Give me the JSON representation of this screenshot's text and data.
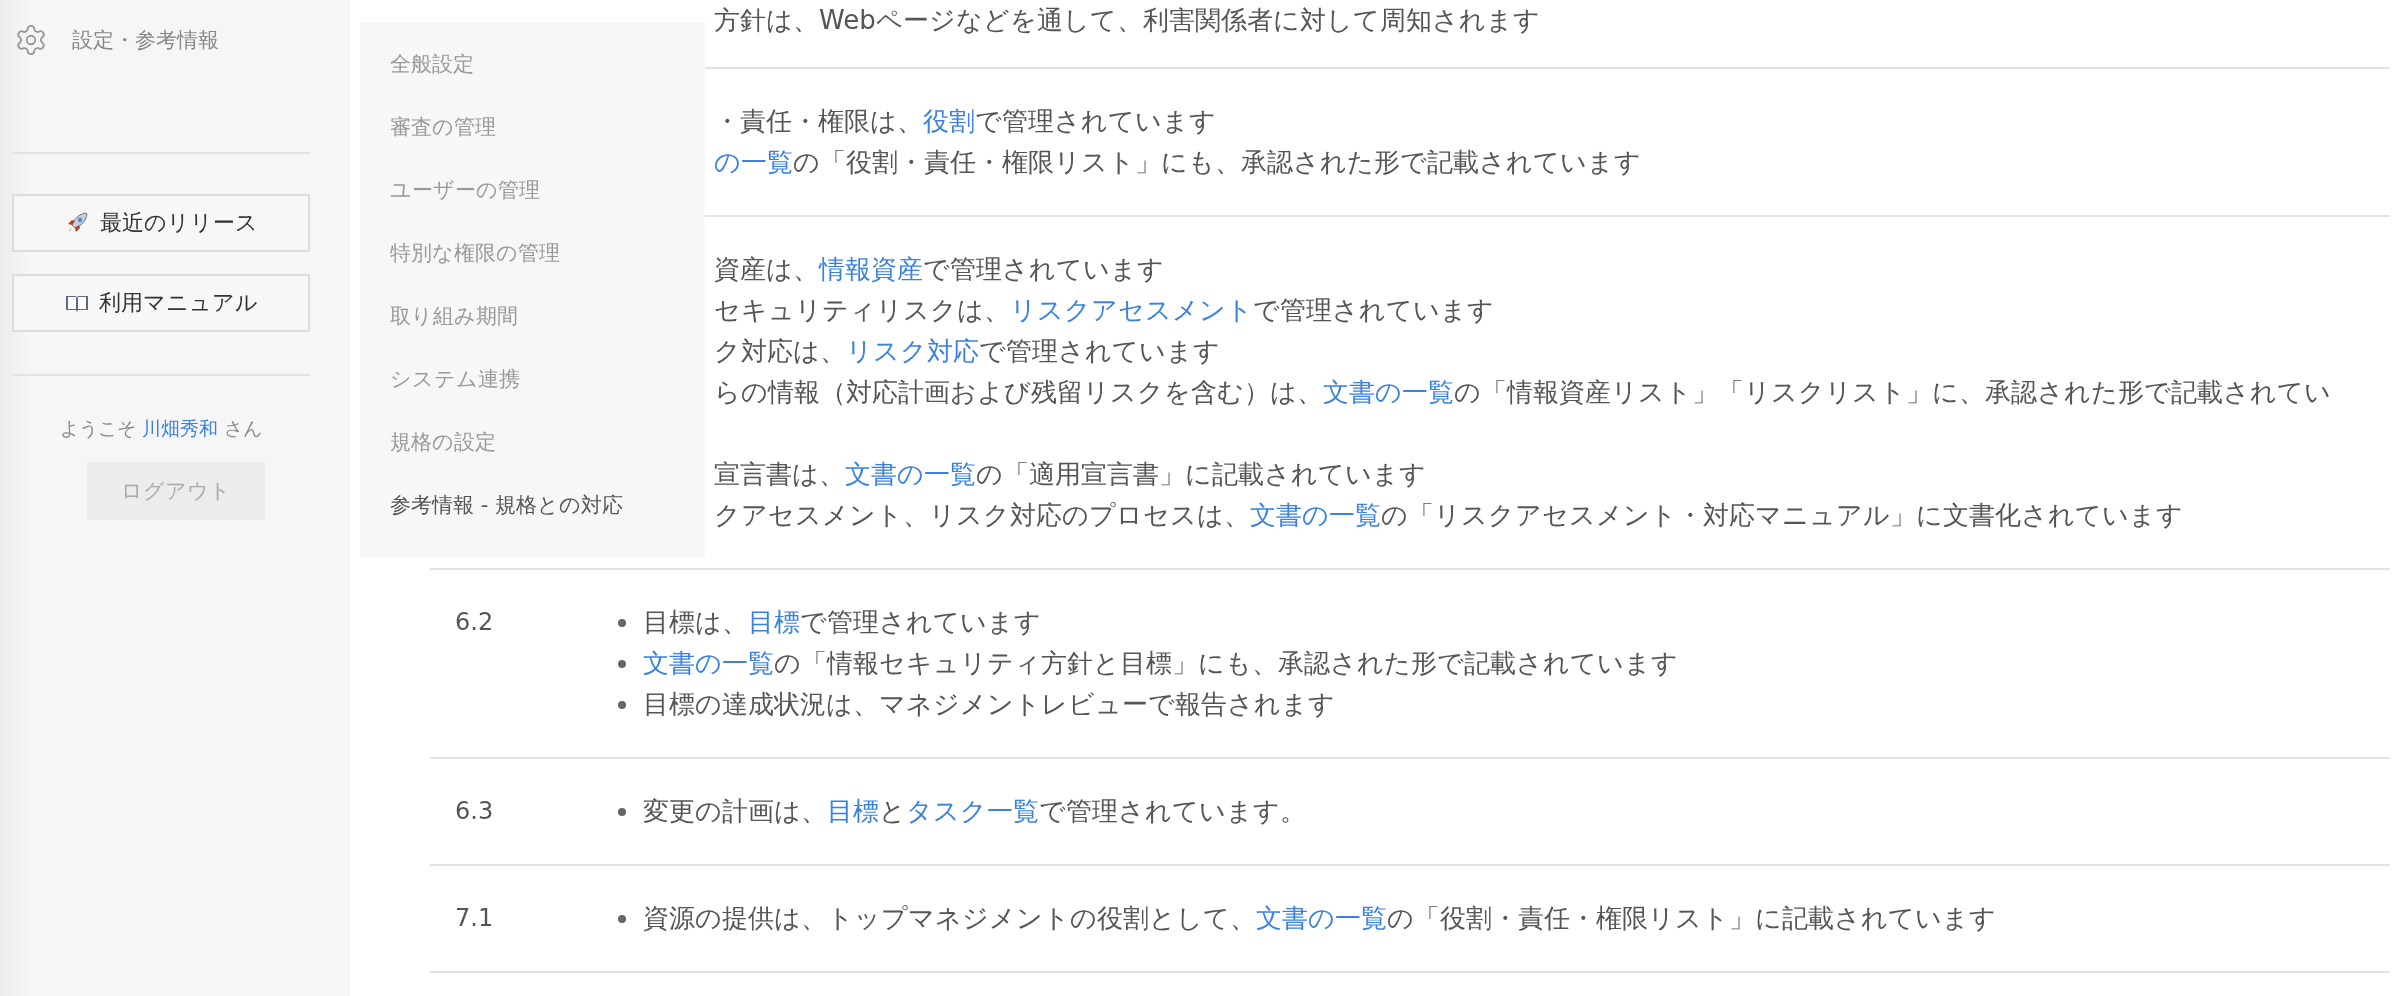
{
  "sidebar": {
    "header": "設定・参考情報",
    "buttons": [
      {
        "label": "最近のリリース"
      },
      {
        "label": "利用マニュアル"
      }
    ],
    "welcome": {
      "prefix": "ようこそ",
      "user": "川畑秀和",
      "suffix": "さん"
    },
    "logout": "ログアウト"
  },
  "menu": [
    {
      "label": "全般設定",
      "selected": false
    },
    {
      "label": "審査の管理",
      "selected": false
    },
    {
      "label": "ユーザーの管理",
      "selected": false
    },
    {
      "label": "特別な権限の管理",
      "selected": false
    },
    {
      "label": "取り組み期間",
      "selected": false
    },
    {
      "label": "システム連携",
      "selected": false
    },
    {
      "label": "規格の設定",
      "selected": false
    },
    {
      "label": "参考情報 - 規格との対応",
      "selected": true
    }
  ],
  "rows": [
    {
      "items": [
        {
          "segments": [
            {
              "kind": "text",
              "text": "方針は、Webページなどを通して、利害関係者に対して周知されます"
            }
          ]
        }
      ]
    },
    {
      "items": [
        {
          "segments": [
            {
              "kind": "text",
              "text": "・責任・権限は、"
            },
            {
              "kind": "link",
              "text": "役割"
            },
            {
              "kind": "text",
              "text": "で管理されています"
            }
          ]
        },
        {
          "segments": [
            {
              "kind": "link",
              "text": "の一覧"
            },
            {
              "kind": "text",
              "text": "の「役割・責任・権限リスト」にも、承認された形で記載されています"
            }
          ]
        }
      ]
    },
    {
      "items": [
        {
          "segments": [
            {
              "kind": "text",
              "text": "資産は、"
            },
            {
              "kind": "link",
              "text": "情報資産"
            },
            {
              "kind": "text",
              "text": "で管理されています"
            }
          ]
        },
        {
          "segments": [
            {
              "kind": "text",
              "text": "セキュリティリスクは、"
            },
            {
              "kind": "link",
              "text": "リスクアセスメント"
            },
            {
              "kind": "text",
              "text": "で管理されています"
            }
          ]
        },
        {
          "segments": [
            {
              "kind": "text",
              "text": "ク対応は、"
            },
            {
              "kind": "link",
              "text": "リスク対応"
            },
            {
              "kind": "text",
              "text": "で管理されています"
            }
          ]
        },
        {
          "wrapped": true,
          "segments": [
            {
              "kind": "text",
              "text": "らの情報（対応計画および残留リスクを含む）は、"
            },
            {
              "kind": "link",
              "text": "文書の一覧"
            },
            {
              "kind": "text",
              "text": "の「情報資産リスト」「リスクリスト」に、承認された形で記載されてい"
            }
          ]
        },
        {
          "segments": [
            {
              "kind": "text",
              "text": "宣言書は、"
            },
            {
              "kind": "link",
              "text": "文書の一覧"
            },
            {
              "kind": "text",
              "text": "の「適用宣言書」に記載されています"
            }
          ]
        },
        {
          "segments": [
            {
              "kind": "text",
              "text": "クアセスメント、リスク対応のプロセスは、"
            },
            {
              "kind": "link",
              "text": "文書の一覧"
            },
            {
              "kind": "text",
              "text": "の「リスクアセスメント・対応マニュアル」に文書化されています"
            }
          ]
        }
      ]
    },
    {
      "number": "6.2",
      "items": [
        {
          "segments": [
            {
              "kind": "text",
              "text": "目標は、"
            },
            {
              "kind": "link",
              "text": "目標"
            },
            {
              "kind": "text",
              "text": "で管理されています"
            }
          ]
        },
        {
          "segments": [
            {
              "kind": "link",
              "text": "文書の一覧"
            },
            {
              "kind": "text",
              "text": "の「情報セキュリティ方針と目標」にも、承認された形で記載されています"
            }
          ]
        },
        {
          "segments": [
            {
              "kind": "text",
              "text": "目標の達成状況は、マネジメントレビューで報告されます"
            }
          ]
        }
      ]
    },
    {
      "number": "6.3",
      "items": [
        {
          "segments": [
            {
              "kind": "text",
              "text": "変更の計画は、"
            },
            {
              "kind": "link",
              "text": "目標"
            },
            {
              "kind": "text",
              "text": "と"
            },
            {
              "kind": "link",
              "text": "タスク一覧"
            },
            {
              "kind": "text",
              "text": "で管理されています。"
            }
          ]
        }
      ]
    },
    {
      "number": "7.1",
      "items": [
        {
          "segments": [
            {
              "kind": "text",
              "text": "資源の提供は、トップマネジメントの役割として、"
            },
            {
              "kind": "link",
              "text": "文書の一覧"
            },
            {
              "kind": "text",
              "text": "の「役割・責任・権限リスト」に記載されています"
            }
          ]
        }
      ]
    }
  ]
}
